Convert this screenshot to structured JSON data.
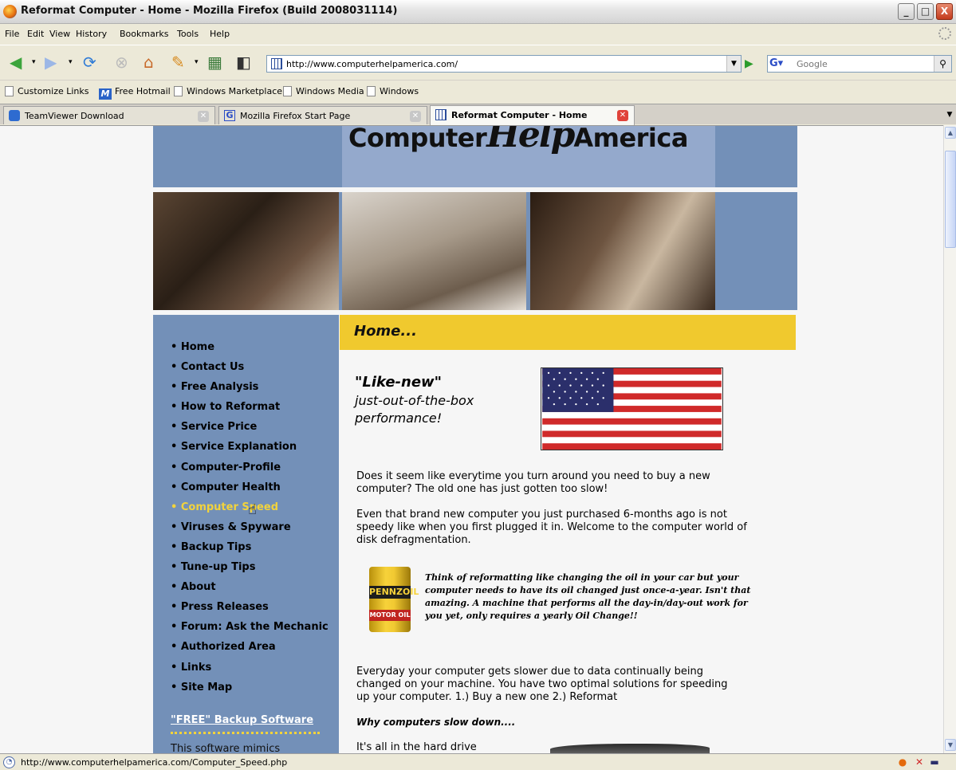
{
  "window": {
    "title": "Reformat Computer - Home - Mozilla Firefox (Build 2008031114)",
    "buttons": [
      "_",
      "□",
      "X"
    ]
  },
  "menu": [
    "File",
    "Edit",
    "View",
    "History",
    "Bookmarks",
    "Tools",
    "Help"
  ],
  "address": {
    "url": "http://www.computerhelpamerica.com/",
    "search_placeholder": "Google"
  },
  "bookmarks": [
    "Customize Links",
    "Free Hotmail",
    "Windows Marketplace",
    "Windows Media",
    "Windows"
  ],
  "tabs": [
    {
      "label": "TeamViewer Download",
      "active": false
    },
    {
      "label": "Mozilla Firefox Start Page",
      "active": false
    },
    {
      "label": "Reformat Computer - Home",
      "active": true
    }
  ],
  "site": {
    "logo_left": "Computer",
    "logo_mid": "Help",
    "logo_right": "America",
    "nav": [
      "Home",
      "Contact Us",
      "Free Analysis",
      "How to Reformat",
      "Service Price",
      "Service Explanation",
      "Computer-Profile",
      "Computer Health",
      "Computer Speed",
      "Viruses & Spyware",
      "Backup Tips",
      "Tune-up Tips",
      "About",
      "Press Releases",
      "Forum: Ask the Mechanic",
      "Authorized Area",
      "Links",
      "Site Map"
    ],
    "nav_hover_index": 8,
    "free_backup_link": "\"FREE\" Backup Software",
    "free_backup_text": "This software mimics",
    "home_heading": "Home...",
    "likenew_title": "\"Like-new\"",
    "likenew_line1": "just-out-of-the-box",
    "likenew_line2": "performance!",
    "para1": "Does it seem like everytime you turn around you need to buy a new computer?  The old one has just gotten too slow!",
    "para2": "Even that brand new computer you just purchased 6-months ago is not speedy like when you first plugged it in.  Welcome to the computer world of disk defragmentation.",
    "oil_brand": "PENNZOIL",
    "oil_label": "MOTOR OIL",
    "oil_quote": "Think of reformatting like changing the oil in your car but your computer needs to have its oil changed just once-a-year.  Isn't that amazing.  A machine that performs all the day-in/day-out work for you yet, only requires a yearly Oil Change!!",
    "para3": "Everyday your computer gets slower due to data continually being changed on your machine.  You have two optimal solutions for speeding up your computer.  1.) Buy a new one  2.) Reformat",
    "why_heading": "Why computers slow down....",
    "para4": "It's all in the hard drive"
  },
  "status": {
    "text": "http://www.computerhelpamerica.com/Computer_Speed.php"
  },
  "colors": {
    "sidebar": "#7390b8",
    "home_bar": "#f0c92e",
    "nav_hover": "#f2d33c"
  }
}
